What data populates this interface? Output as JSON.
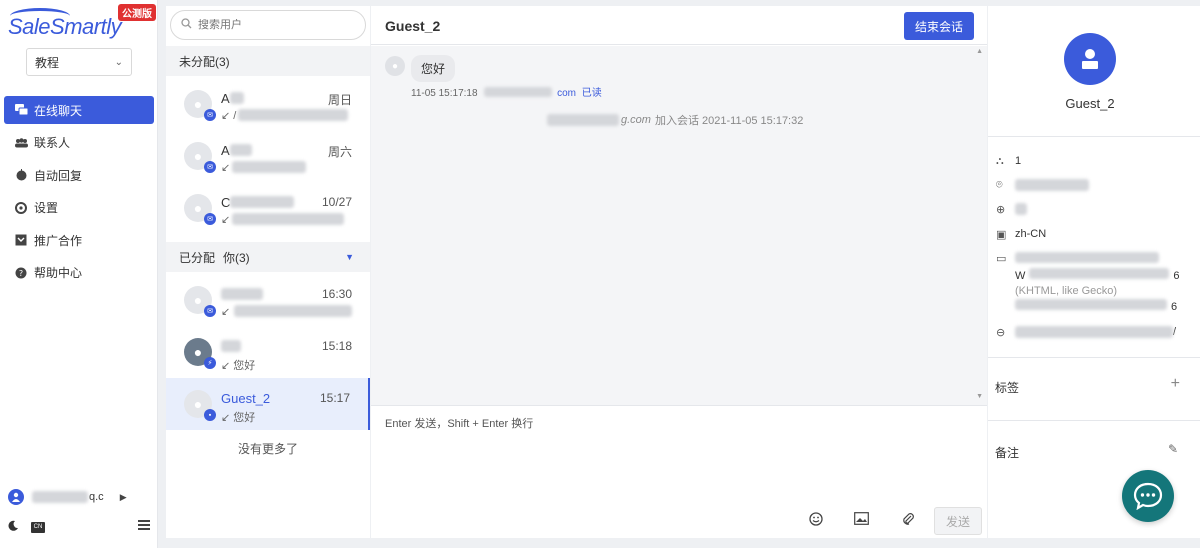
{
  "app": {
    "logo_text": "SaleSmartly",
    "beta_badge": "公测版"
  },
  "workspace": {
    "selected": "教程"
  },
  "sidebar": {
    "items": [
      {
        "label": "在线聊天",
        "icon": "chat-icon",
        "active": true
      },
      {
        "label": "联系人",
        "icon": "contacts-icon",
        "active": false
      },
      {
        "label": "自动回复",
        "icon": "robot-icon",
        "active": false
      },
      {
        "label": "设置",
        "icon": "gear-icon",
        "active": false
      },
      {
        "label": "推广合作",
        "icon": "promo-icon",
        "active": false
      },
      {
        "label": "帮助中心",
        "icon": "help-icon",
        "active": false
      }
    ],
    "user_suffix": "q.c"
  },
  "convlist": {
    "search_placeholder": "搜索用户",
    "unassigned_label": "未分配(3)",
    "assigned_label": "已分配",
    "assigned_filter": "你(3)",
    "unassigned": [
      {
        "name": "A",
        "time": "周日",
        "preview": "↙ /"
      },
      {
        "name": "A",
        "time": "周六",
        "preview": "↙"
      },
      {
        "name": "C",
        "time": "10/27",
        "preview": "↙"
      }
    ],
    "assigned": [
      {
        "name": "",
        "time": "16:30",
        "preview": "↙"
      },
      {
        "name": "",
        "time": "15:18",
        "preview": "↙ 您好"
      },
      {
        "name": "Guest_2",
        "time": "15:17",
        "preview": "↙ 您好"
      }
    ],
    "no_more": "没有更多了"
  },
  "chat": {
    "title": "Guest_2",
    "end_button": "结束会话",
    "message": {
      "text": "您好",
      "time": "11-05 15:17:18",
      "domain_suffix": "com",
      "status": "已读"
    },
    "system_message": {
      "prefix": "g.com",
      "text": "加入会话 2021-11-05 15:17:32"
    },
    "composer_placeholder": "Enter 发送，Shift + Enter 换行",
    "send_button": "发送"
  },
  "info": {
    "name": "Guest_2",
    "visits": "1",
    "language": "zh-CN",
    "ua_fragment_1": "W",
    "ua_fragment_2": "6",
    "ua_fragment_3": "(KHTML, like Gecko)",
    "ua_fragment_4": "6",
    "url_tail": "/",
    "tags_label": "标签",
    "notes_label": "备注"
  },
  "colors": {
    "primary": "#3b5bdb",
    "fab": "#14767a",
    "beta": "#e03131"
  }
}
